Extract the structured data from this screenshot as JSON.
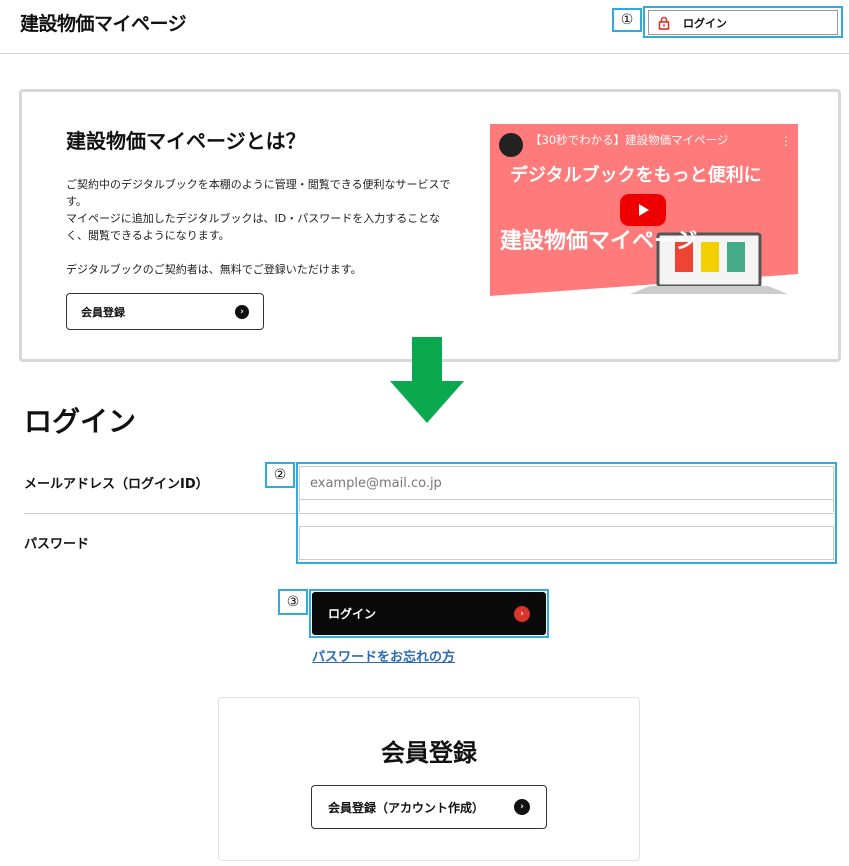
{
  "header": {
    "site_title": "建設物価マイページ",
    "login_label": "ログイン",
    "annotation_1": "①"
  },
  "intro": {
    "title": "建設物価マイページとは？",
    "p1": "ご契約中のデジタルブックを本棚のように管理・閲覧できる便利なサービスです。",
    "p2": "マイページに追加したデジタルブックは、ID・パスワードを入力することなく、閲覧できるようになります。",
    "p3": "デジタルブックのご契約者は、無料でご登録いただけます。",
    "register_label": "会員登録"
  },
  "video": {
    "title": "【30秒でわかる】建設物価マイページ",
    "subtitle": "デジタルブックをもっと便利に",
    "big_text": "建設物価マイページ",
    "bg_color": "#ff7a7a"
  },
  "login": {
    "heading": "ログイン",
    "email_label": "メールアドレス（ログインID）",
    "email_placeholder": "example@mail.co.jp",
    "password_label": "パスワード",
    "annotation_2": "②",
    "annotation_3": "③",
    "button_label": "ログイン",
    "forgot_label": "パスワードをお忘れの方"
  },
  "register": {
    "title": "会員登録",
    "button_label": "会員登録（アカウント作成）"
  },
  "colors": {
    "annotation_border": "#33aadd",
    "arrow_green": "#0aa84f",
    "login_button": "#0a0a0a",
    "link": "#2a6bb8"
  }
}
